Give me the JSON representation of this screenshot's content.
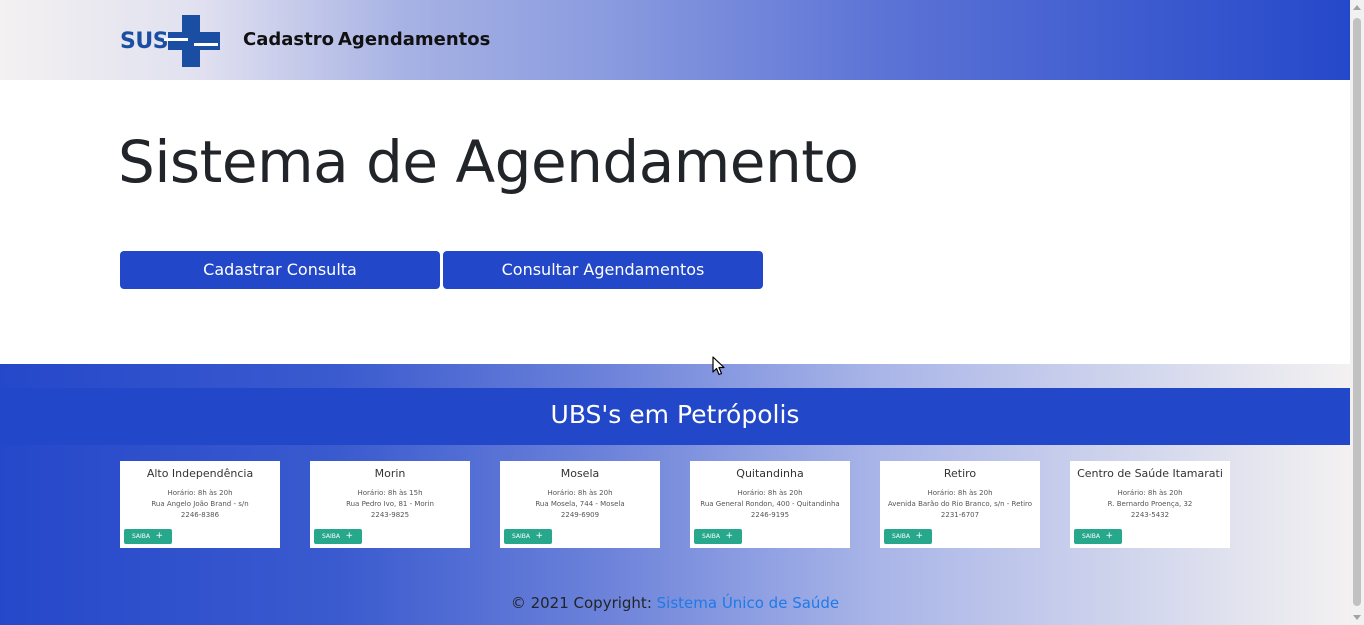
{
  "nav": {
    "logo_text": "SUS",
    "links": [
      "Cadastro",
      "Agendamentos"
    ]
  },
  "main": {
    "title": "Sistema de Agendamento",
    "buttons": [
      "Cadastrar Consulta",
      "Consultar Agendamentos"
    ]
  },
  "footer": {
    "title": "UBS's em Petrópolis",
    "cards": [
      {
        "name": "Alto Independência",
        "hours": "Horário: 8h às 20h",
        "address": "Rua Angelo João Brand - s/n",
        "phone": "2246-8386",
        "button": "SAIBA"
      },
      {
        "name": "Morin",
        "hours": "Horário: 8h às 15h",
        "address": "Rua Pedro Ivo, 81 - Morin",
        "phone": "2243-9825",
        "button": "SAIBA"
      },
      {
        "name": "Mosela",
        "hours": "Horário: 8h às 20h",
        "address": "Rua Mosela, 744 - Mosela",
        "phone": "2249-6909",
        "button": "SAIBA"
      },
      {
        "name": "Quitandinha",
        "hours": "Horário: 8h às 20h",
        "address": "Rua General Rondon, 400 - Quitandinha",
        "phone": "2246-9195",
        "button": "SAIBA"
      },
      {
        "name": "Retiro",
        "hours": "Horário: 8h às 20h",
        "address": "Avenida Barão do Rio Branco, s/n - Retiro",
        "phone": "2231-6707",
        "button": "SAIBA"
      },
      {
        "name": "Centro de Saúde Itamarati",
        "hours": "Horário: 8h às 20h",
        "address": "R. Bernardo Proença, 32",
        "phone": "2243-5432",
        "button": "SAIBA"
      }
    ],
    "copyright_prefix": "© 2021 Copyright: ",
    "copyright_link": "Sistema Único de Saúde"
  },
  "colors": {
    "primary": "#2248c9",
    "saiba_green": "#27a78b",
    "link_blue": "#1f7ae6",
    "logo_blue": "#1a4ea3"
  }
}
